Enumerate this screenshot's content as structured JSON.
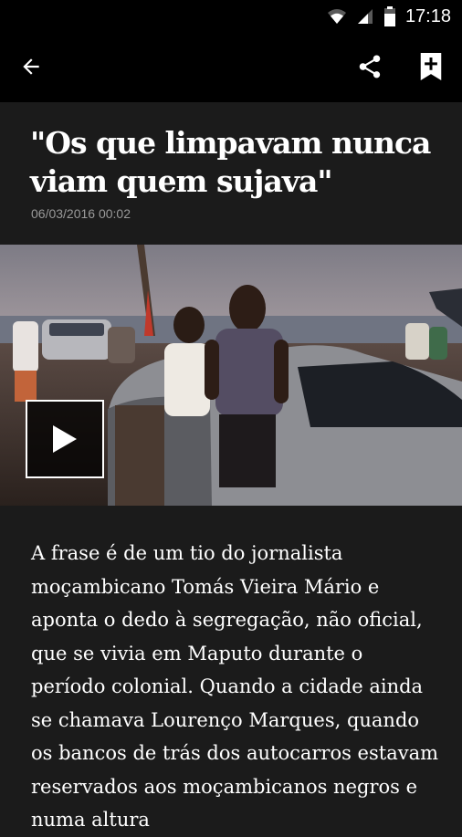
{
  "status_bar": {
    "time": "17:18",
    "icons": [
      "wifi-icon",
      "signal-icon",
      "battery-icon"
    ]
  },
  "app_bar": {
    "back_icon": "arrow-left-icon",
    "share_icon": "share-icon",
    "bookmark_icon": "bookmark-add-icon"
  },
  "article": {
    "headline": "\"Os que limpavam nunca viam quem sujava\"",
    "date": "06/03/2016 00:02",
    "media": {
      "play_icon": "play-icon"
    },
    "body": "A frase é de um tio do jornalista moçambicano Tomás Vieira Mário e aponta o dedo à segregação, não oficial, que se vivia em Maputo durante o período colonial. Quando a cidade ainda se chamava Lourenço Marques, quando os bancos de trás dos autocarros estavam reservados aos moçambicanos negros e numa altura"
  },
  "colors": {
    "background": "#1b1b1b",
    "bar": "#000000",
    "date_text": "#9a9a9a"
  }
}
